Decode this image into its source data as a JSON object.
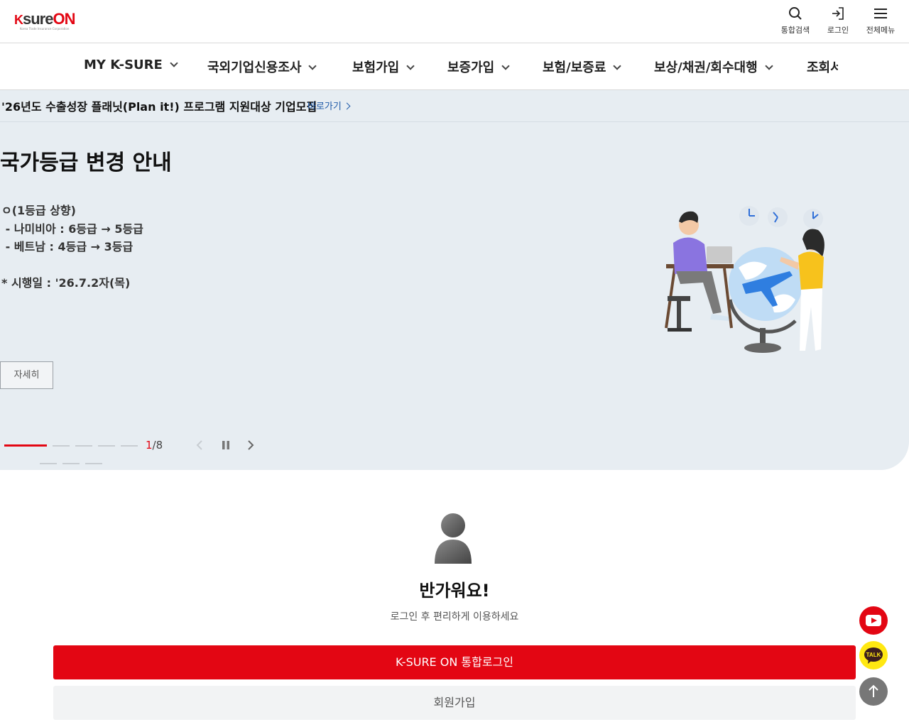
{
  "header": {
    "logo_text_k": "K",
    "logo_text_sure": "sure",
    "logo_text_on": "ON",
    "logo_sub": "Korea Trade Insurance Corporation",
    "utils": [
      {
        "label": "통합검색",
        "icon": "search-icon"
      },
      {
        "label": "로그인",
        "icon": "login-icon"
      },
      {
        "label": "전체메뉴",
        "icon": "hamburger-menu-icon"
      }
    ]
  },
  "gnb": {
    "items": [
      {
        "label": "MY K-SURE"
      },
      {
        "label": "국외기업신용조사"
      },
      {
        "label": "보험가입"
      },
      {
        "label": "보증가입"
      },
      {
        "label": "보험/보증료"
      },
      {
        "label": "보상/채권/회수대행"
      },
      {
        "label": "조회서"
      }
    ]
  },
  "notice": {
    "text": "'26년도 수출성장 플래닛(Plan it!) 프로그램 지원대상 기업모집",
    "link_label": "바로가기"
  },
  "hero": {
    "title": "국가등급 변경 안내",
    "body": "ㅇ(1등급 상향)\n - 나미비아 : 6등급 → 5등급\n - 베트남 : 4등급 → 3등급\n\n* 시행일 : '26.7.2자(목)",
    "detail_label": "자세히",
    "current_slide": "1",
    "total_slides": "/8"
  },
  "login": {
    "welcome": "반가워요!",
    "sub": "로그인 후 편리하게 이용하세요",
    "login_button": "K-SURE ON 통합로그인",
    "join_button": "회원가입"
  },
  "floating": {
    "talk_label": "TALK"
  },
  "colors": {
    "brand_red": "#e30613",
    "hero_bg": "#e7edf2",
    "link_blue": "#1f5aa8",
    "kakao_yellow": "#ffe812"
  }
}
